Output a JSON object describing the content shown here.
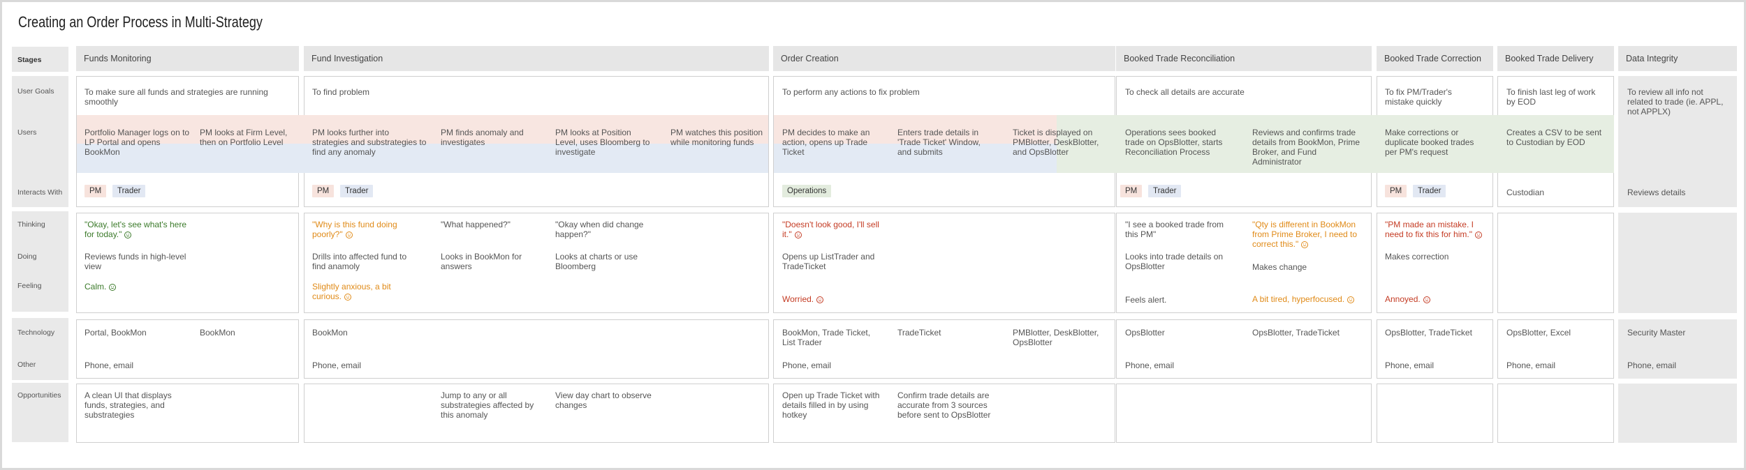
{
  "title": "Creating an Order Process in Multi-Strategy",
  "row_labels": {
    "stages": "Stages",
    "user_goals": "User Goals",
    "users": "Users",
    "interacts_with": "Interacts With",
    "thinking": "Thinking",
    "doing": "Doing",
    "feeling": "Feeling",
    "technology": "Technology",
    "other": "Other",
    "opportunities": "Opportunities"
  },
  "stages": [
    "Funds Monitoring",
    "Fund Investigation",
    "Order Creation",
    "Booked Trade Reconciliation",
    "Booked Trade Correction",
    "Booked Trade Delivery",
    "Data Integrity"
  ],
  "goals": [
    "To make sure all funds and strategies are running smoothly",
    "To find problem",
    "To perform any actions to fix problem",
    "To check all details are accurate",
    "To fix PM/Trader's mistake quickly",
    "To finish last leg of work by EOD",
    "To review all info not related to trade (ie. APPL, not APPLX)"
  ],
  "users": [
    "Portfolio Manager logs on to LP Portal and opens BookMon",
    "PM looks at Firm Level, then on Portfolio Level",
    "PM looks further into strategies and substrategies to find any anomaly",
    "PM finds anomaly and investigates",
    "PM looks at Position Level, uses Bloomberg to investigate",
    "PM watches this position while monitoring funds",
    "PM decides to make an action, opens up Trade Ticket",
    "Enters trade details in 'Trade Ticket' Window, and submits",
    "Ticket is displayed on PMBlotter, DeskBlotter, and OpsBlotter",
    "Operations sees booked trade on OpsBlotter, starts Reconciliation Process",
    "Reviews and confirms trade details from BookMon, Prime Broker, and Fund Administrator",
    "Make corrections or duplicate booked trades per PM's request",
    "Creates a CSV to be sent to Custodian by EOD"
  ],
  "interacts": {
    "pm": "PM",
    "trader": "Trader",
    "operations": "Operations",
    "custodian": "Custodian",
    "reviews": "Reviews details"
  },
  "thinking": [
    "\"Okay, let's see what's here for today.\"",
    "\"Why is this fund doing poorly?\"",
    "\"What happened?\"",
    "\"Okay when did change happen?\"",
    "\"Doesn't look good, I'll sell it.\"",
    "\"I see a booked trade from this PM\"",
    "\"Qty is different in BookMon from Prime Broker, I need to correct this.\"",
    "\"PM made an mistake. I need to fix this for him.\""
  ],
  "doing": [
    "Reviews funds in high-level view",
    "Drills into affected fund to find anamoly",
    "Looks in BookMon for answers",
    "Looks at charts or use Bloomberg",
    "Opens up ListTrader and TradeTicket",
    "Looks into trade details on OpsBlotter",
    "Makes change",
    "Makes correction"
  ],
  "feeling": [
    "Calm.",
    "Slightly anxious, a bit curious.",
    "Worried.",
    "Feels alert.",
    "A bit tired, hyperfocused.",
    "Annoyed."
  ],
  "technology": [
    "Portal, BookMon",
    "BookMon",
    "BookMon",
    "BookMon, Trade Ticket, List Trader",
    "TradeTicket",
    "PMBlotter, DeskBlotter, OpsBlotter",
    "OpsBlotter",
    "OpsBlotter, TradeTicket",
    "OpsBlotter, TradeTicket",
    "OpsBlotter, Excel",
    "Security Master"
  ],
  "other": "Phone, email",
  "opportunities": [
    "A clean UI that displays funds, strategies, and substrategies",
    "Jump to any or all substrategies affected by this anomaly",
    "View day chart to observe changes",
    "Open up Trade Ticket with details filled in by using hotkey",
    "Confirm trade details are accurate from 3 sources before sent to OpsBlotter"
  ],
  "colors": {
    "pm_band": "#f8e6e1",
    "trader_band": "#e3eaf4",
    "ops_band": "#e6eee2",
    "happy": "#3b7a2a",
    "neutral": "#e08a17",
    "unhappy": "#c43b23"
  },
  "icons": [
    "smile-icon",
    "frown-icon"
  ]
}
